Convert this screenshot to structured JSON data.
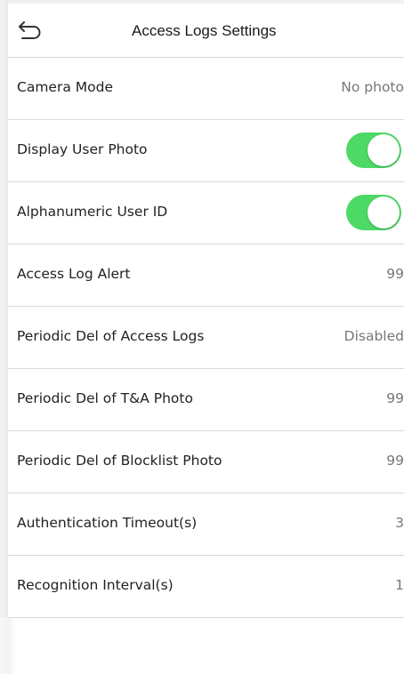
{
  "header": {
    "title": "Access Logs Settings",
    "back_icon": "back-arrow-icon"
  },
  "settings": [
    {
      "label": "Camera Mode",
      "value": "No photo",
      "type": "value"
    },
    {
      "label": "Display User Photo",
      "value": "",
      "type": "toggle",
      "on": true
    },
    {
      "label": "Alphanumeric User ID",
      "value": "",
      "type": "toggle",
      "on": true
    },
    {
      "label": "Access Log Alert",
      "value": "99",
      "type": "value"
    },
    {
      "label": "Periodic Del of Access Logs",
      "value": "Disabled",
      "type": "value"
    },
    {
      "label": "Periodic Del of T&A Photo",
      "value": "99",
      "type": "value"
    },
    {
      "label": "Periodic Del of Blocklist Photo",
      "value": "99",
      "type": "value"
    },
    {
      "label": "Authentication Timeout(s)",
      "value": "3",
      "type": "value"
    },
    {
      "label": "Recognition Interval(s)",
      "value": "1",
      "type": "value"
    }
  ],
  "colors": {
    "toggle_on": "#4cd964",
    "divider": "#d9d9d9",
    "label_text": "#222222",
    "value_text": "#777777"
  }
}
